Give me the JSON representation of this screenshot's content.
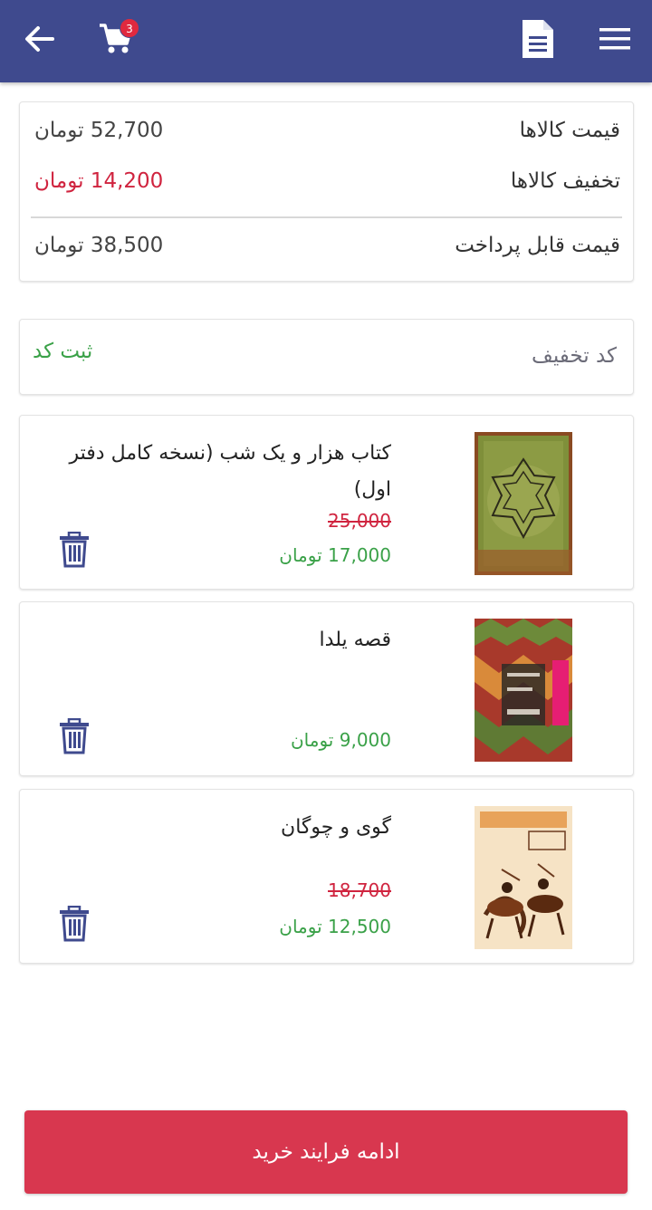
{
  "header": {
    "cart_count": "3",
    "colors": {
      "bar": "#3f4a8e",
      "badge": "#e0293e"
    },
    "icons": [
      "back-arrow-icon",
      "cart-icon",
      "document-icon",
      "menu-icon"
    ]
  },
  "summary": {
    "items_price_label": "قیمت کالاها",
    "items_price_value": "52,700 تومان",
    "discount_label": "تخفیف کالاها",
    "discount_value": "14,200 تومان",
    "payable_label": "قیمت قابل پرداخت",
    "payable_value": "38,500 تومان"
  },
  "coupon": {
    "placeholder": "کد تخفیف",
    "submit_label": "ثبت کد"
  },
  "cart_items": [
    {
      "title": "کتاب هزار و یک شب (نسخه کامل دفتر اول)",
      "old_price": "25,000",
      "price": "17,000 تومان"
    },
    {
      "title": "قصه یلدا",
      "old_price": "",
      "price": "9,000 تومان"
    },
    {
      "title": "گوی و چوگان",
      "old_price": "18,700",
      "price": "12,500 تومان"
    }
  ],
  "checkout": {
    "label": "ادامه فرایند خرید"
  },
  "colors": {
    "accent_red": "#d8374f",
    "green": "#3aa148",
    "price_red": "#d0243f"
  }
}
